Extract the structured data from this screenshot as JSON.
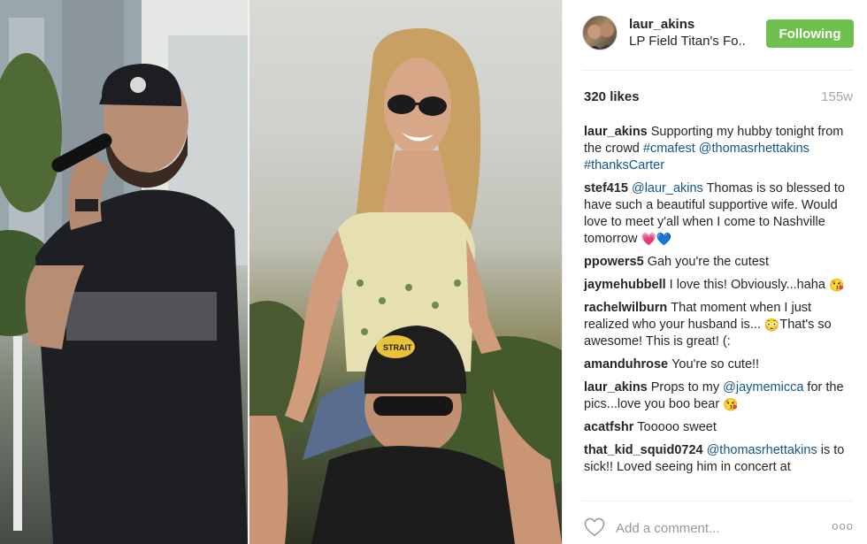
{
  "post": {
    "username": "laur_akins",
    "location": "LP Field Titan's Fo..",
    "follow_label": "Following",
    "likes": "320 likes",
    "time": "155w"
  },
  "comments": [
    {
      "author": "laur_akins",
      "parts": [
        "Supporting my hubby tonight from the crowd ",
        {
          "tag": "#cmafest"
        },
        " ",
        {
          "tag": "@thomasrhettakins"
        },
        " ",
        {
          "tag": "#thanksCarter"
        }
      ]
    },
    {
      "author": "stef415",
      "parts": [
        {
          "tag": "@laur_akins"
        },
        " Thomas is so blessed to have such a beautiful supportive wife. Would love to meet y'all when I come to Nashville tomorrow ",
        {
          "emoji": "💗💙"
        }
      ]
    },
    {
      "author": "ppowers5",
      "parts": [
        "Gah you're the cutest"
      ]
    },
    {
      "author": "jaymehubbell",
      "parts": [
        "I love this! Obviously...haha ",
        {
          "emoji": "😘"
        }
      ]
    },
    {
      "author": "rachelwilburn",
      "parts": [
        "That moment when I just realized who your husband is... ",
        {
          "emoji": "😳"
        },
        "That's so awesome! This is great! (:"
      ]
    },
    {
      "author": "amanduhrose",
      "parts": [
        "You're so cute!!"
      ]
    },
    {
      "author": "laur_akins",
      "parts": [
        "Props to my ",
        {
          "tag": "@jaymemicca"
        },
        " for the pics...love you boo bear ",
        {
          "emoji": "😘"
        }
      ]
    },
    {
      "author": "acatfshr",
      "parts": [
        "Tooooo sweet"
      ]
    },
    {
      "author": "that_kid_squid0724",
      "parts": [
        {
          "tag": "@thomasrhettakins"
        },
        " is to sick!! Loved seeing him in concert at"
      ]
    }
  ],
  "footer": {
    "placeholder": "Add a comment...",
    "more": "ooo"
  },
  "photo": {
    "left_cap_text": "",
    "right_cap_text": "STRAIT"
  },
  "icons": {
    "like": "heart-outline-icon",
    "more": "more-options-icon"
  },
  "colors": {
    "follow_button": "#70c050",
    "tag_link": "#125688",
    "muted": "#a5a7aa"
  }
}
